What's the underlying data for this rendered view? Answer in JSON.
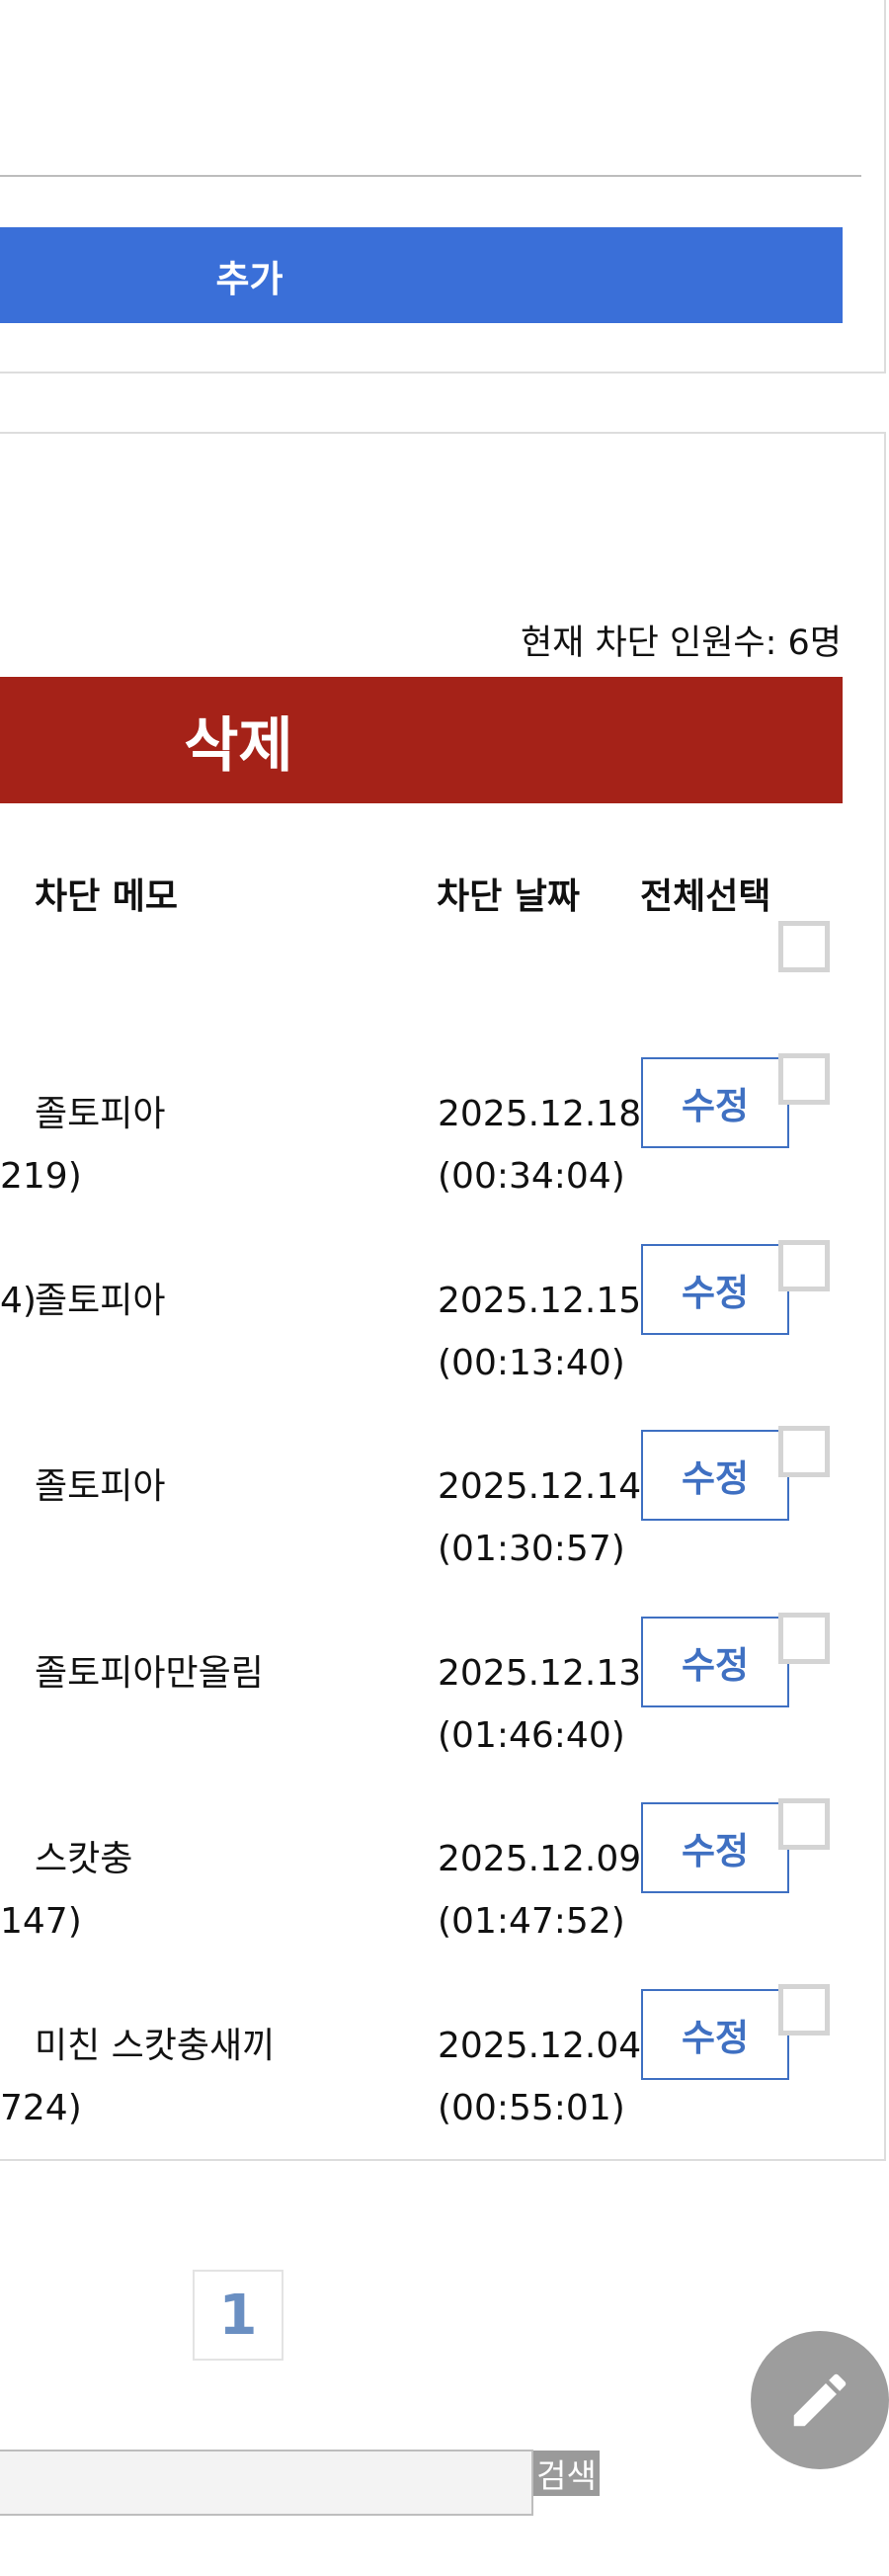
{
  "add_panel": {
    "add_label": "추가"
  },
  "block_list": {
    "count_text": "현재 차단 인원수: 6명",
    "delete_label": "삭제",
    "headers": {
      "memo": "차단 메모",
      "date": "차단 날짜",
      "select_all": "전체선택"
    },
    "edit_label": "수정",
    "rows": [
      {
        "id_fragment": "",
        "id_line2": "219)",
        "memo": "졸토피아",
        "date": "2025.12.18",
        "time": "(00:34:04)"
      },
      {
        "id_fragment": "4)",
        "id_line2": "",
        "memo": "졸토피아",
        "date": "2025.12.15",
        "time": "(00:13:40)"
      },
      {
        "id_fragment": "",
        "id_line2": "",
        "memo": "졸토피아",
        "date": "2025.12.14",
        "time": "(01:30:57)"
      },
      {
        "id_fragment": "",
        "id_line2": "",
        "memo": "졸토피아만올림",
        "date": "2025.12.13",
        "time": "(01:46:40)"
      },
      {
        "id_fragment": "",
        "id_line2": "147)",
        "memo": "스캇충",
        "date": "2025.12.09",
        "time": "(01:47:52)"
      },
      {
        "id_fragment": "",
        "id_line2": "724)",
        "memo": "미친 스캇충새끼",
        "date": "2025.12.04",
        "time": "(00:55:01)"
      }
    ]
  },
  "pagination": {
    "current_page": "1"
  },
  "search": {
    "button_label": "검색",
    "placeholder": ""
  },
  "icons": {
    "fab": "pencil-icon"
  },
  "colors": {
    "add_button": "#3a6fd8",
    "delete_button": "#a52218",
    "edit_button_border": "#3f70c2",
    "fab": "#9d9d9d"
  }
}
